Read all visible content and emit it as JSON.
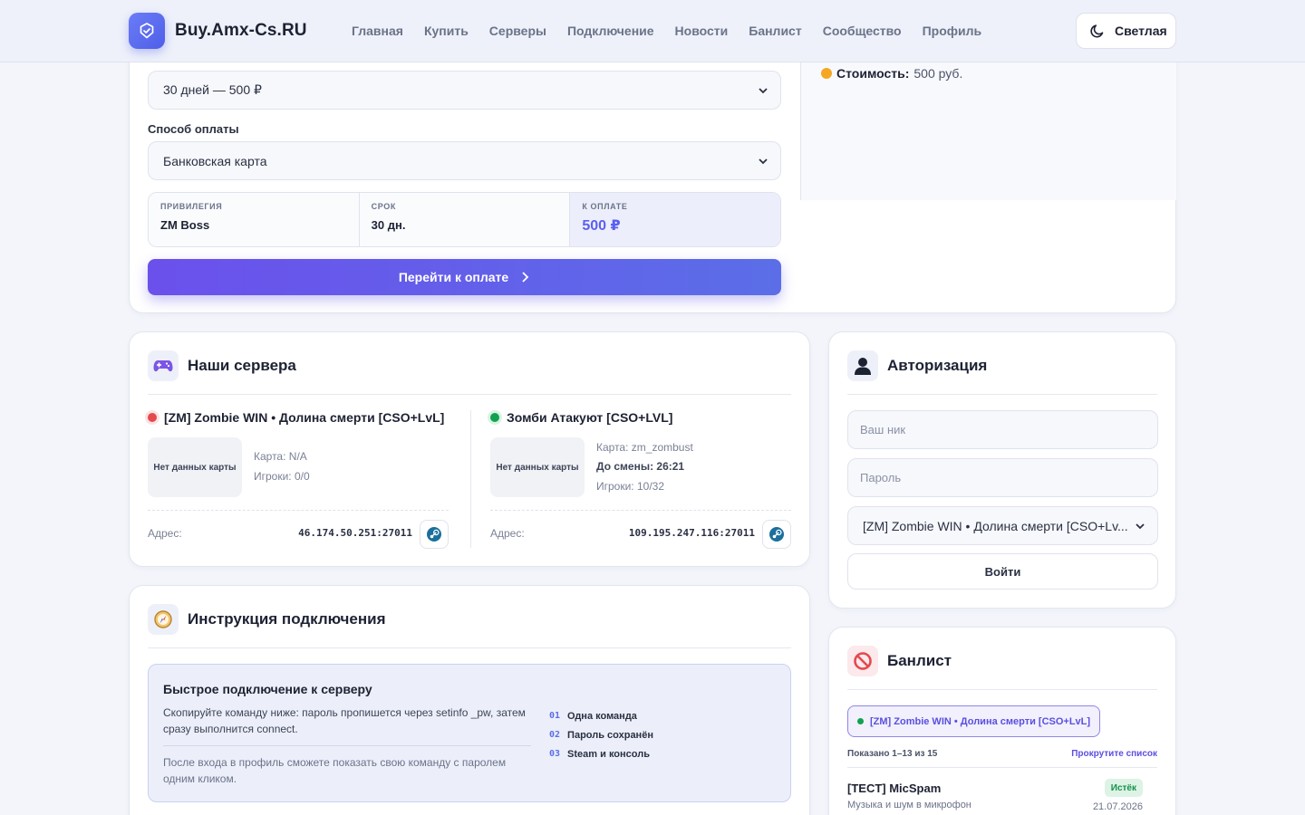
{
  "header": {
    "brand": "Buy.Amx-Cs.RU",
    "nav": [
      "Главная",
      "Купить",
      "Серверы",
      "Подключение",
      "Новости",
      "Банлист",
      "Сообщество",
      "Профиль"
    ],
    "theme_label": "Светлая"
  },
  "purchase": {
    "period_value": "30 дней — 500 ₽",
    "payment_label": "Способ оплаты",
    "payment_value": "Банковская карта",
    "summary": {
      "privilege_key": "ПРИВИЛЕГИЯ",
      "privilege_val": "ZM Boss",
      "term_key": "СРОК",
      "term_val": "30 дн.",
      "total_key": "К ОПЛАТЕ",
      "total_val": "500 ₽"
    },
    "pay_button": "Перейти к оплате",
    "cost_label": "Стоимость:",
    "cost_value": "500 руб."
  },
  "servers": {
    "title": "Наши сервера",
    "items": [
      {
        "name": "[ZM] Zombie WIN • Долина смерти [CSO+LvL]",
        "status": "offline",
        "map_placeholder": "Нет данных карты",
        "map": "Карта: N/A",
        "players": "Игроки: 0/0",
        "address_label": "Адрес:",
        "address": "46.174.50.251:27011"
      },
      {
        "name": "Зомби Атакуют [CSO+LVL]",
        "status": "online",
        "map_placeholder": "Нет данных карты",
        "map": "Карта: zm_zombust",
        "change": "До смены: 26:21",
        "players": "Игроки: 10/32",
        "address_label": "Адрес:",
        "address": "109.195.247.116:27011"
      }
    ]
  },
  "instructions": {
    "title": "Инструкция подключения",
    "box_title": "Быстрое подключение к серверу",
    "text": "Скопируйте команду ниже: пароль пропишется через setinfo _pw, затем сразу выполнится connect.",
    "note": "После входа в профиль сможете показать свою команду с паролем одним кликом.",
    "steps": [
      {
        "num": "01",
        "label": "Одна команда"
      },
      {
        "num": "02",
        "label": "Пароль сохранён"
      },
      {
        "num": "03",
        "label": "Steam и консоль"
      }
    ]
  },
  "auth": {
    "title": "Авторизация",
    "nick_placeholder": "Ваш ник",
    "password_placeholder": "Пароль",
    "server_select": "[ZM] Zombie WIN • Долина смерти [CSO+Lv...",
    "login_button": "Войти"
  },
  "banlist": {
    "title": "Банлист",
    "server_chip": "[ZM] Zombie WIN • Долина смерти [CSO+LvL]",
    "shown": "Показано 1–13 из 15",
    "scroll_hint": "Прокрутите список",
    "entry": {
      "name": "[TECT] MicSpam",
      "reason": "Музыка и шум в микрофон",
      "status": "Истёк",
      "date": "21.07.2026"
    }
  },
  "colors": {
    "accent": "#5b5ff0",
    "online": "#12a150",
    "offline": "#e5484d",
    "cost_dot": "#f5a623"
  }
}
